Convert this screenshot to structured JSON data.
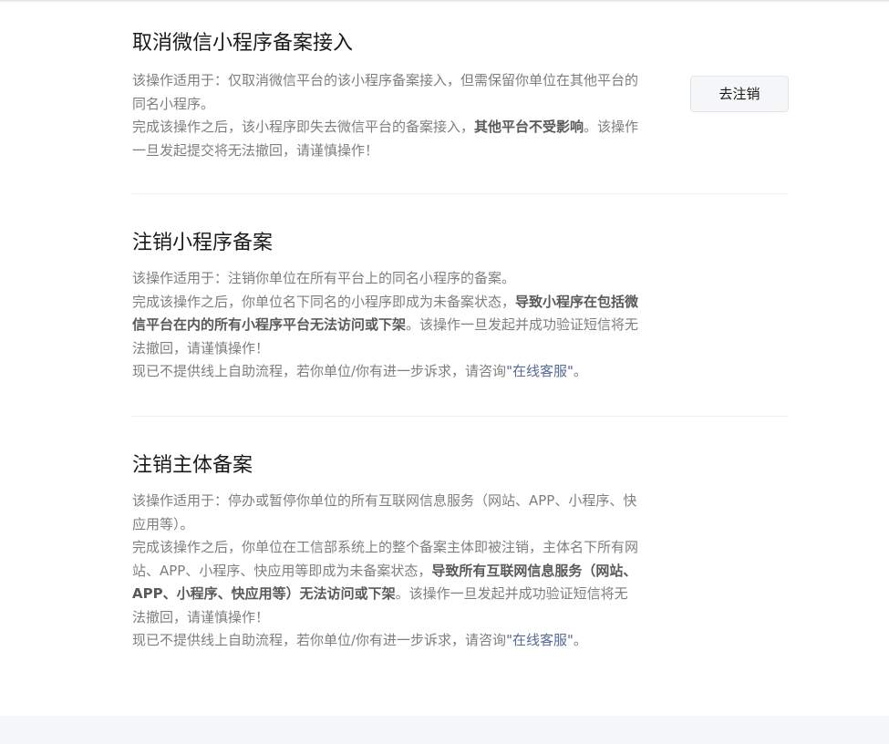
{
  "sections": [
    {
      "title": "取消微信小程序备案接入",
      "lines": [
        {
          "text": "该操作适用于：仅取消微信平台的该小程序备案接入，但需保留你单位在其他平台的同名小程序。"
        },
        {
          "pre": "完成该操作之后，该小程序即失去微信平台的备案接入，",
          "bold": "其他平台不受影响",
          "post": "。该操作一旦发起提交将无法撤回，请谨慎操作！"
        }
      ],
      "button_label": "去注销"
    },
    {
      "title": "注销小程序备案",
      "lines": [
        {
          "text": "该操作适用于：注销你单位在所有平台上的同名小程序的备案。"
        },
        {
          "pre": "完成该操作之后，你单位名下同名的小程序即成为未备案状态，",
          "bold": "导致小程序在包括微信平台在内的所有小程序平台无法访问或下架",
          "post": "。该操作一旦发起并成功验证短信将无法撤回，请谨慎操作！"
        },
        {
          "pre": "现已不提供线上自助流程，若你单位/你有进一步诉求，请咨询",
          "link": "\"在线客服\"",
          "post": "。"
        }
      ]
    },
    {
      "title": "注销主体备案",
      "lines": [
        {
          "text": "该操作适用于：停办或暂停你单位的所有互联网信息服务（网站、APP、小程序、快应用等）。"
        },
        {
          "pre": "完成该操作之后，你单位在工信部系统上的整个备案主体即被注销，主体名下所有网站、APP、小程序、快应用等即成为未备案状态，",
          "bold": "导致所有互联网信息服务（网站、APP、小程序、快应用等）无法访问或下架",
          "post": "。该操作一旦发起并成功验证短信将无法撤回，请谨慎操作！"
        },
        {
          "pre": "现已不提供线上自助流程，若你单位/你有进一步诉求，请咨询",
          "link": "\"在线客服\"",
          "post": "。"
        }
      ]
    }
  ]
}
